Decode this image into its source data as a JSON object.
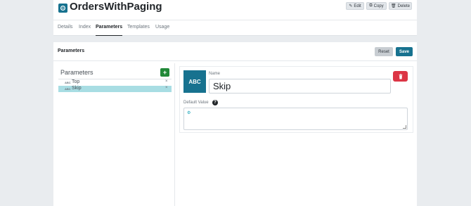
{
  "header": {
    "title": "OrdersWithPaging",
    "icon": "query-icon",
    "buttons": {
      "edit": "Edit",
      "copy": "Copy",
      "delete": "Delete"
    }
  },
  "tabs": [
    {
      "label": "Details",
      "active": false
    },
    {
      "label": "Index",
      "active": false
    },
    {
      "label": "Parameters",
      "active": true
    },
    {
      "label": "Templates",
      "active": false
    },
    {
      "label": "Usage",
      "active": false
    }
  ],
  "section": {
    "title": "Parameters",
    "reset_label": "Reset",
    "save_label": "Save"
  },
  "parameters": {
    "title": "Parameters",
    "add_icon": "+",
    "type_icon": "ABC",
    "remove_icon": "×",
    "items": [
      {
        "label": "Top",
        "selected": false
      },
      {
        "label": "Skip",
        "selected": true
      }
    ]
  },
  "detail": {
    "type_tile": "ABC",
    "name_label": "Name",
    "name_value": "Skip",
    "default_value_label": "Default Value",
    "help_icon": "?",
    "default_value": ""
  },
  "colors": {
    "accent": "#17728f",
    "add": "#218838",
    "danger": "#dc3545",
    "selected_row": "#a8dde3"
  }
}
